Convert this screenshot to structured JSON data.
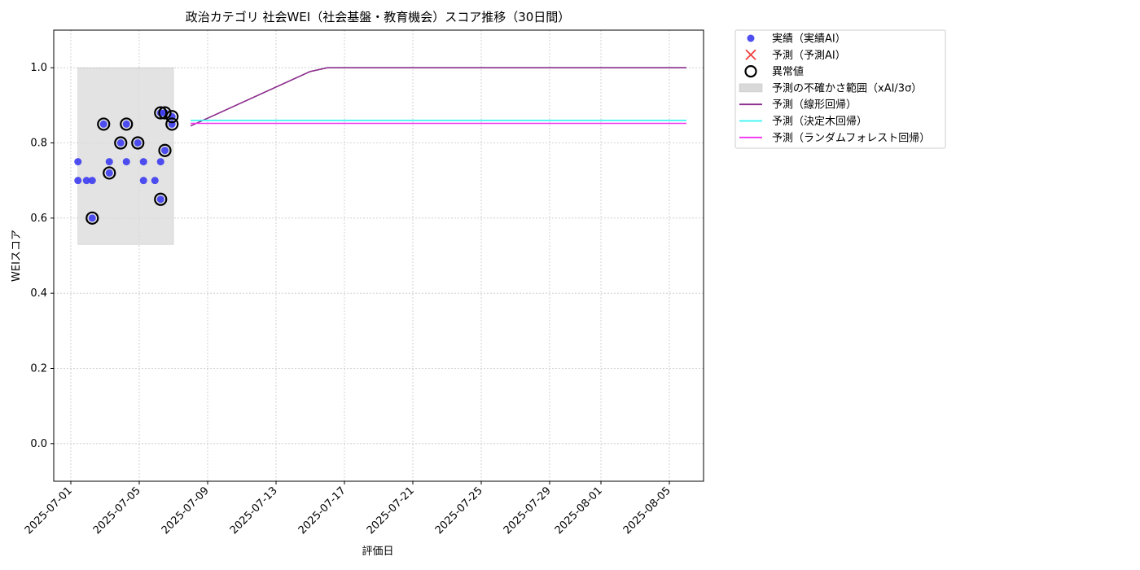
{
  "chart_data": {
    "type": "scatter",
    "title": "政治カテゴリ 社会WEI（社会基盤・教育機会）スコア推移（30日間）",
    "xlabel": "評価日",
    "ylabel": "WEIスコア",
    "xlim": [
      "2025-06-30T00:00",
      "2025-08-07T00:00"
    ],
    "ylim": [
      -0.1,
      1.1
    ],
    "y_ticks": [
      0.0,
      0.2,
      0.4,
      0.6,
      0.8,
      1.0
    ],
    "y_tick_labels": [
      "0.0",
      "0.2",
      "0.4",
      "0.6",
      "0.8",
      "1.0"
    ],
    "x_ticks": [
      "2025-07-01",
      "2025-07-05",
      "2025-07-09",
      "2025-07-13",
      "2025-07-17",
      "2025-07-21",
      "2025-07-25",
      "2025-07-29",
      "2025-08-01",
      "2025-08-05"
    ],
    "grid": true,
    "legend_position": "outside-upper-right",
    "legend": [
      {
        "label": "実績（実績AI）",
        "kind": "dot",
        "color": "#3b3bf0"
      },
      {
        "label": "予測（予測AI）",
        "kind": "cross",
        "color": "#f04040"
      },
      {
        "label": "異常値",
        "kind": "ring",
        "color": "#000000"
      },
      {
        "label": "予測の不確かさ範囲（xAI/3σ）",
        "kind": "patch",
        "color": "#d9d9d9"
      },
      {
        "label": "予測（線形回帰）",
        "kind": "line",
        "color": "#8b2c8c"
      },
      {
        "label": "予測（決定木回帰）",
        "kind": "line",
        "color": "#33f5f5"
      },
      {
        "label": "予測（ランダムフォレスト回帰）",
        "kind": "line",
        "color": "#f033f0"
      }
    ],
    "uncertainty_band": {
      "x": [
        "2025-07-01T10:00",
        "2025-07-07T00:00"
      ],
      "y": [
        0.53,
        1.0
      ],
      "color": "#d9d9d9"
    },
    "series": [
      {
        "name": "実績（実績AI）",
        "kind": "scatter",
        "color": "#3b3bf0",
        "points": [
          {
            "x": "2025-07-01T10:00",
            "y": 0.75
          },
          {
            "x": "2025-07-01T10:00",
            "y": 0.7
          },
          {
            "x": "2025-07-01T22:00",
            "y": 0.7
          },
          {
            "x": "2025-07-02T06:00",
            "y": 0.7
          },
          {
            "x": "2025-07-02T06:00",
            "y": 0.6
          },
          {
            "x": "2025-07-02T22:00",
            "y": 0.85
          },
          {
            "x": "2025-07-03T06:00",
            "y": 0.75
          },
          {
            "x": "2025-07-03T06:00",
            "y": 0.72
          },
          {
            "x": "2025-07-03T22:00",
            "y": 0.8
          },
          {
            "x": "2025-07-04T06:00",
            "y": 0.75
          },
          {
            "x": "2025-07-04T06:00",
            "y": 0.85
          },
          {
            "x": "2025-07-04T22:00",
            "y": 0.8
          },
          {
            "x": "2025-07-05T06:00",
            "y": 0.75
          },
          {
            "x": "2025-07-05T06:00",
            "y": 0.7
          },
          {
            "x": "2025-07-05T22:00",
            "y": 0.7
          },
          {
            "x": "2025-07-06T06:00",
            "y": 0.75
          },
          {
            "x": "2025-07-06T06:00",
            "y": 0.65
          },
          {
            "x": "2025-07-06T06:00",
            "y": 0.88
          },
          {
            "x": "2025-07-06T12:00",
            "y": 0.88
          },
          {
            "x": "2025-07-06T12:00",
            "y": 0.78
          },
          {
            "x": "2025-07-06T22:00",
            "y": 0.87
          },
          {
            "x": "2025-07-06T22:00",
            "y": 0.85
          }
        ]
      },
      {
        "name": "異常値",
        "kind": "ring",
        "color": "#000000",
        "points": [
          {
            "x": "2025-07-02T06:00",
            "y": 0.6
          },
          {
            "x": "2025-07-02T22:00",
            "y": 0.85
          },
          {
            "x": "2025-07-03T06:00",
            "y": 0.72
          },
          {
            "x": "2025-07-03T22:00",
            "y": 0.8
          },
          {
            "x": "2025-07-04T06:00",
            "y": 0.85
          },
          {
            "x": "2025-07-04T22:00",
            "y": 0.8
          },
          {
            "x": "2025-07-06T06:00",
            "y": 0.65
          },
          {
            "x": "2025-07-06T06:00",
            "y": 0.88
          },
          {
            "x": "2025-07-06T12:00",
            "y": 0.88
          },
          {
            "x": "2025-07-06T12:00",
            "y": 0.78
          },
          {
            "x": "2025-07-06T22:00",
            "y": 0.87
          },
          {
            "x": "2025-07-06T22:00",
            "y": 0.85
          }
        ]
      },
      {
        "name": "予測（線形回帰）",
        "kind": "line",
        "color": "#8b2c8c",
        "points": [
          {
            "x": "2025-07-08T00:00",
            "y": 0.845
          },
          {
            "x": "2025-07-15T00:00",
            "y": 0.99
          },
          {
            "x": "2025-07-16T00:00",
            "y": 1.0
          },
          {
            "x": "2025-08-06T00:00",
            "y": 1.0
          }
        ]
      },
      {
        "name": "予測（決定木回帰）",
        "kind": "line",
        "color": "#33f5f5",
        "points": [
          {
            "x": "2025-07-08T00:00",
            "y": 0.86
          },
          {
            "x": "2025-08-06T00:00",
            "y": 0.86
          }
        ]
      },
      {
        "name": "予測（ランダムフォレスト回帰）",
        "kind": "line",
        "color": "#f033f0",
        "points": [
          {
            "x": "2025-07-08T00:00",
            "y": 0.852
          },
          {
            "x": "2025-08-06T00:00",
            "y": 0.852
          }
        ]
      }
    ]
  }
}
